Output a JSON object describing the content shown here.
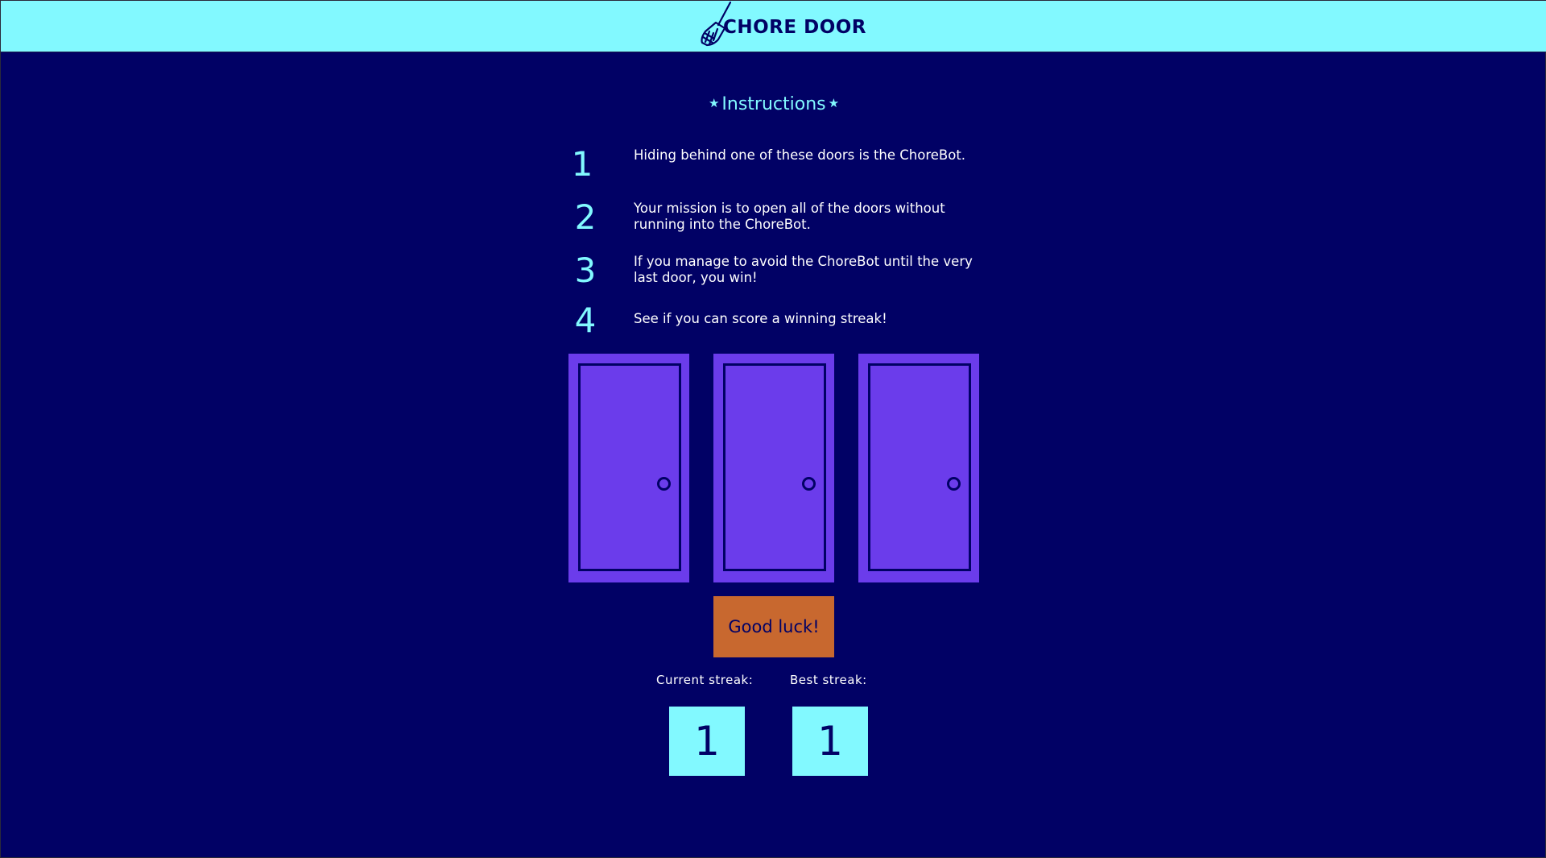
{
  "header": {
    "title": "CHORE DOOR",
    "logo_icon": "broom-icon"
  },
  "instructions": {
    "title": "Instructions",
    "star_glyph": "★",
    "steps": [
      {
        "number": "1",
        "text": "Hiding behind one of these doors is the ChoreBot."
      },
      {
        "number": "2",
        "text": "Your mission is to open all of the doors without running into the ChoreBot."
      },
      {
        "number": "3",
        "text": "If you manage to avoid the ChoreBot until the very last door, you win!"
      },
      {
        "number": "4",
        "text": "See if you can score a winning streak!"
      }
    ]
  },
  "doors": [
    {
      "state": "closed",
      "color": "#6b3ceb"
    },
    {
      "state": "closed",
      "color": "#6b3ceb"
    },
    {
      "state": "closed",
      "color": "#6b3ceb"
    }
  ],
  "start_button": {
    "label": "Good luck!"
  },
  "score": {
    "current_label": "Current streak:",
    "current_value": "1",
    "best_label": "Best streak:",
    "best_value": "1"
  },
  "colors": {
    "background": "#010165",
    "accent": "#82f9ff",
    "door": "#6b3ceb",
    "button": "#c8682f",
    "text": "#ffffff"
  }
}
